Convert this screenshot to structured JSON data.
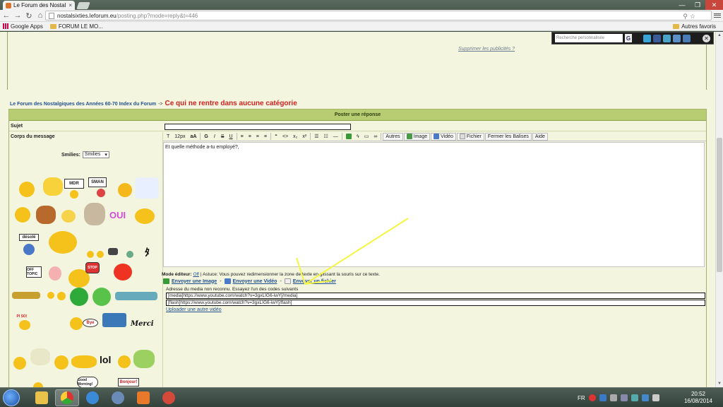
{
  "browser": {
    "tab_title": "Le Forum des Nostal",
    "tab_close": "×",
    "url_host": "nostalsixties.leforum.eu",
    "url_path": "/posting.php?mode=reply&t=446",
    "bookmarks": [
      {
        "label": "Google Apps",
        "icon": "apps-grid-icon"
      },
      {
        "label": "FORUM LE MO...",
        "icon": "folder-icon"
      }
    ],
    "other_bookmarks": "Autres favoris"
  },
  "page": {
    "ad_link": "Supprimer les publicités ?",
    "google_bar": {
      "placeholder": "Recherche personnalisée",
      "button": "G"
    },
    "breadcrumb": {
      "link": "Le Forum des Nostalgiques des Années 60-70 Index du Forum",
      "arrow": "->",
      "current": "Ce qui ne rentre dans aucune catégorie"
    },
    "post": {
      "header": "Poster une réponse",
      "subject_label": "Sujet",
      "subject_value": "",
      "body_label": "Corps du message",
      "smilies_label": "Smilies:",
      "smilies_select": "Smilies",
      "toolbar": {
        "font_size": "12px",
        "aa": "aA",
        "bold": "G",
        "italic": "I",
        "strike": "S",
        "underline": "U",
        "quote": "“",
        "code": "<>",
        "autres": "Autres",
        "image": "Image",
        "video": "Vidéo",
        "fichier": "Fichier",
        "fermer": "Fermer les Balises",
        "aide": "Aide"
      },
      "body_text": "Et quelle méthode a-tu employé?,",
      "mode_editor_label": "Mode éditeur:",
      "mode_editor_value": "Off",
      "mode_editor_tip": "| Astuce: Vous pouvez redimensionner la zone de texte en glissant la souris sur ce texte.",
      "send_image": "Envoyer une Image",
      "send_video": "Envoyer une Vidéo",
      "send_file": "Envoyer un fichier",
      "send_sep": "-",
      "media_error": "Adresse du media non reconnu. Essayez l'un des codes suivants",
      "code_media": "[media]https://www.youtube.com/watch?v=3gxLIG6-iwY[/media]",
      "code_flash": "[flash]https://www.youtube.com/watch?v=3gxLIG6-iwY[/flash]",
      "upload_other": "Uploader une autre vidéo",
      "smilies_words": {
        "mdr": "MDR",
        "sign2": "SMAN",
        "desole": "désolé",
        "off_topic": "OFF TOPIC",
        "stop": "STOP",
        "oui": "OUI",
        "bye": "Bye",
        "merci": "Merci",
        "lol": "lol",
        "good_morning": "Good Morning!",
        "bonjour": "Bonjour!",
        "pi_so": "PI SO!"
      }
    }
  },
  "taskbar": {
    "lang": "FR",
    "time": "20:52",
    "date": "16/08/2014"
  },
  "colors": {
    "header_green": "#b8cd72",
    "link_blue": "#1f4f8f",
    "category_red": "#d02020",
    "annotation_yellow": "#f5f542"
  }
}
